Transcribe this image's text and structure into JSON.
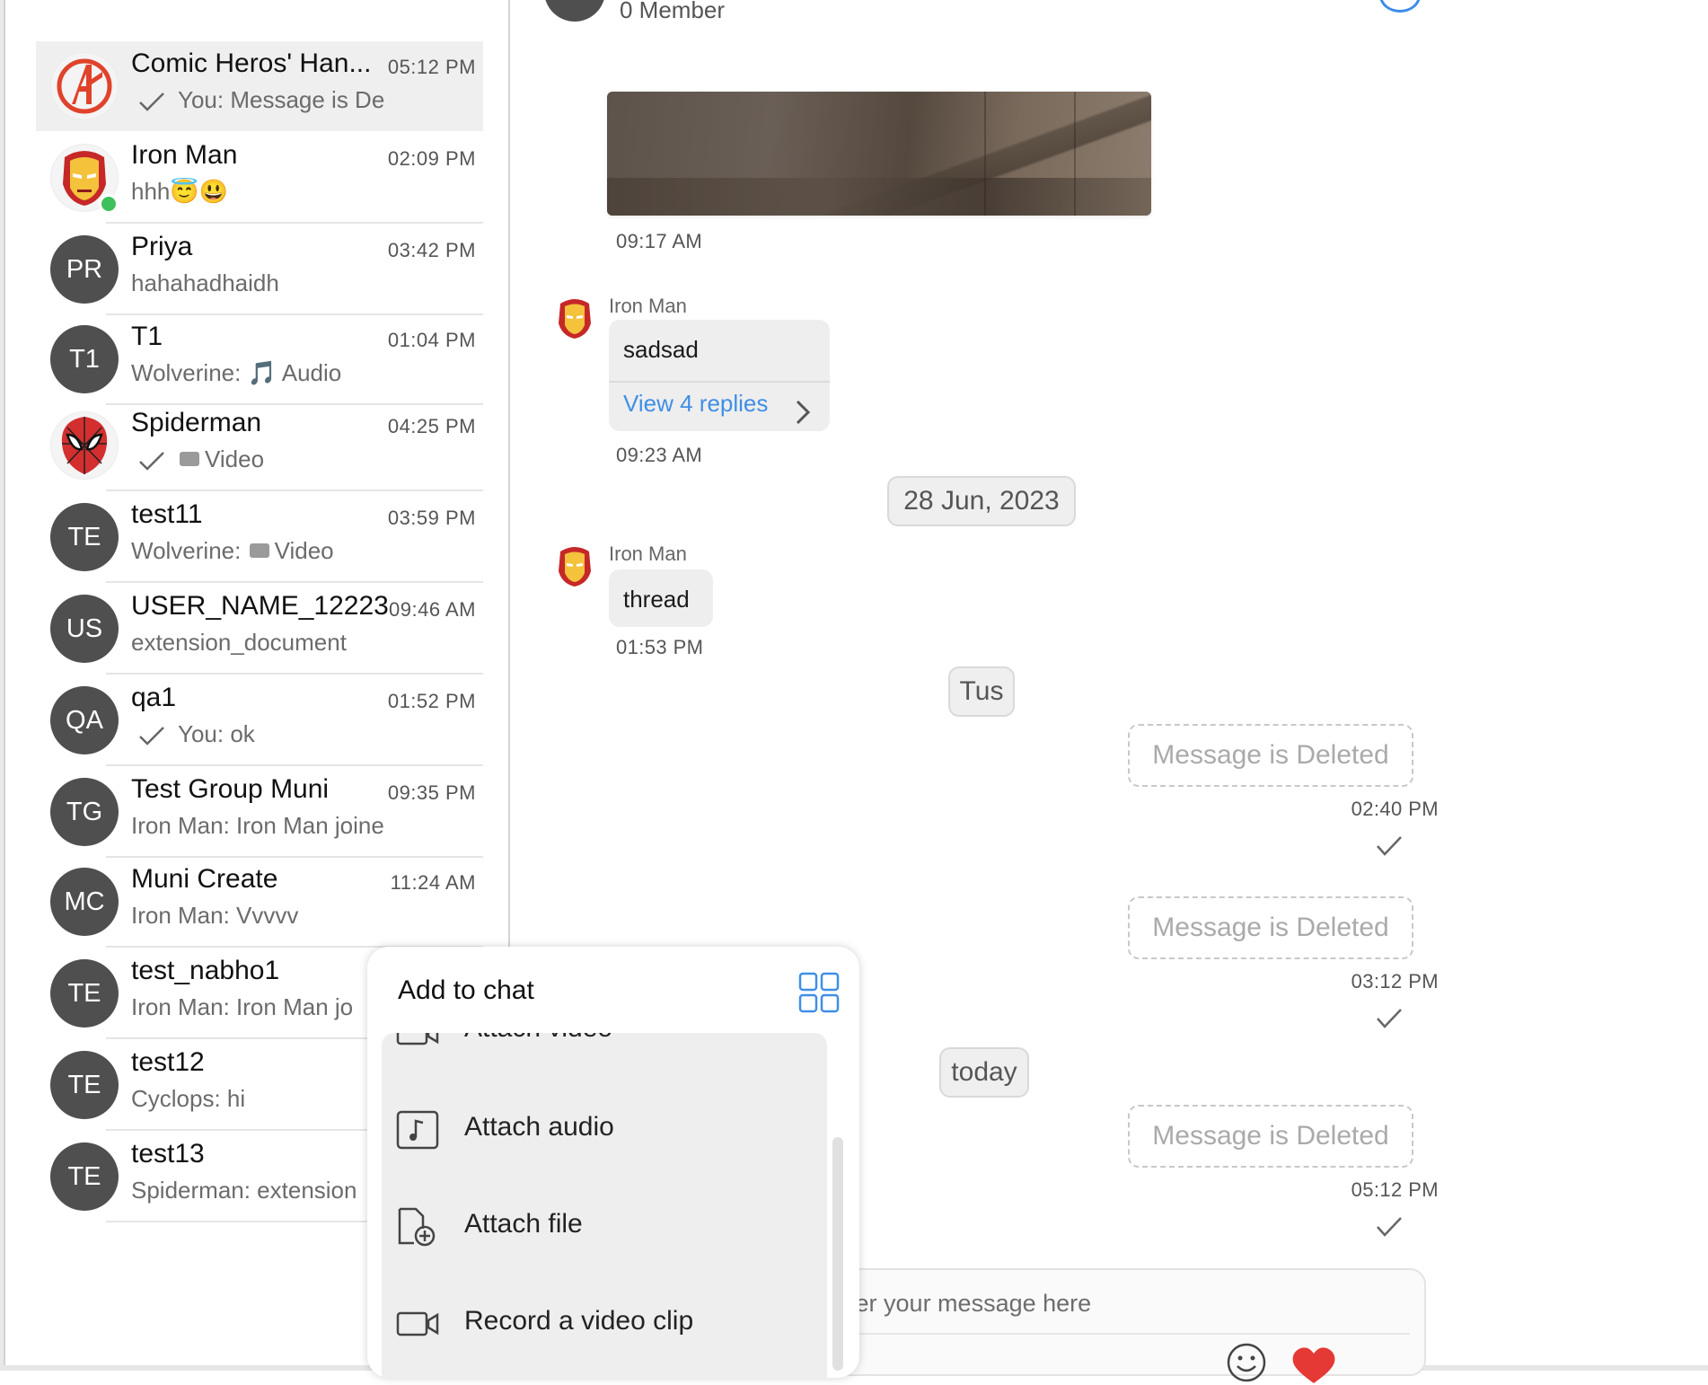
{
  "colors": {
    "accent": "#3f8fe6",
    "online": "#3ec15a",
    "heart": "#e53935",
    "avatar_bg": "#4f4f4f"
  },
  "conversations": [
    {
      "name": "Comic Heros' Han...",
      "time": "05:12 PM",
      "preview": "You: Message is De",
      "avatar": "avengers-logo",
      "tick": true,
      "active": true
    },
    {
      "name": "Iron Man",
      "time": "02:09 PM",
      "preview": "hhh😇😃",
      "avatar": "ironman-mask",
      "online": true
    },
    {
      "name": "Priya",
      "time": "03:42 PM",
      "preview": "hahahadhaidh",
      "initials": "PR"
    },
    {
      "name": "T1",
      "time": "01:04 PM",
      "preview": "Wolverine: 🎵 Audio",
      "initials": "T1"
    },
    {
      "name": "Spiderman",
      "time": "04:25 PM",
      "preview": "Video",
      "avatar": "spiderman-mask",
      "tick": true,
      "media": "video-camera"
    },
    {
      "name": "test11",
      "time": "03:59 PM",
      "preview_prefix": "Wolverine:",
      "preview": "Video",
      "initials": "TE",
      "media": "video-camera"
    },
    {
      "name": "USER_NAME_12223",
      "time": "09:46 AM",
      "preview": "extension_document",
      "initials": "US"
    },
    {
      "name": "qa1",
      "time": "01:52 PM",
      "preview": "You: ok",
      "initials": "QA",
      "tick": true
    },
    {
      "name": "Test Group Muni",
      "time": "09:35 PM",
      "preview": "Iron Man: Iron Man joine",
      "initials": "TG"
    },
    {
      "name": "Muni Create",
      "time": "11:24 AM",
      "preview": "Iron Man: Vvvvv",
      "initials": "MC"
    },
    {
      "name": "test_nabho1",
      "time": "",
      "preview": "Iron Man: Iron Man jo",
      "initials": "TE"
    },
    {
      "name": "test12",
      "time": "",
      "preview": "Cyclops: hi",
      "initials": "TE"
    },
    {
      "name": "test13",
      "time": "",
      "preview": "Spiderman: extension",
      "initials": "TE"
    }
  ],
  "header": {
    "members": "0 Member"
  },
  "messages": {
    "image_time": "09:17 AM",
    "msg1": {
      "sender": "Iron Man",
      "text": "sadsad",
      "replies": "View 4 replies",
      "time": "09:23 AM"
    },
    "date1": "28 Jun, 2023",
    "msg2": {
      "sender": "Iron Man",
      "text": "thread",
      "time": "01:53 PM"
    },
    "date2": "Tus",
    "deleted_text": "Message is Deleted",
    "out1_time": "02:40 PM",
    "out2_time": "03:12 PM",
    "date3": "today",
    "out3_time": "05:12 PM"
  },
  "composer": {
    "placeholder": "Enter your message here",
    "emoji_icon": "smiley-icon",
    "heart_icon": "heart-icon"
  },
  "popup": {
    "title": "Add to chat",
    "items": [
      {
        "label": "Attach video",
        "icon": "video-icon"
      },
      {
        "label": "Attach audio",
        "icon": "music-file-icon"
      },
      {
        "label": "Attach file",
        "icon": "file-add-icon"
      },
      {
        "label": "Record a video clip",
        "icon": "video-camera-icon"
      }
    ]
  }
}
